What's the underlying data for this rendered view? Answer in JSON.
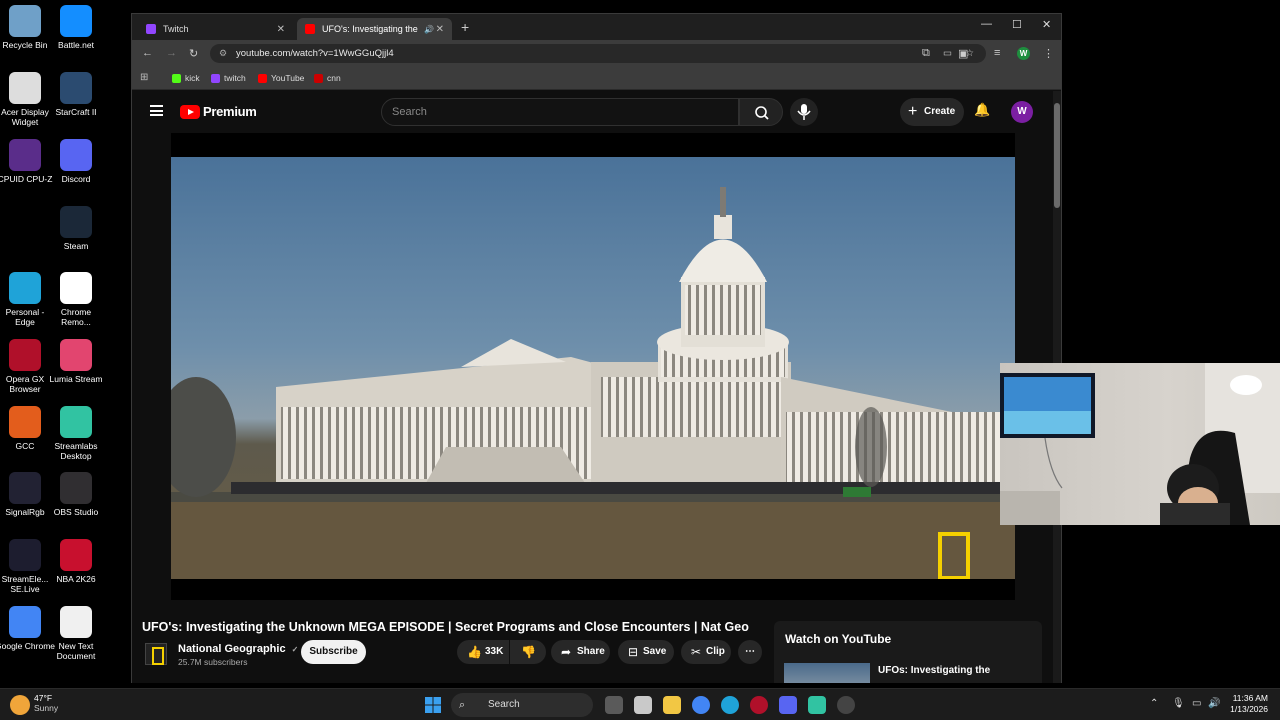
{
  "desktop": {
    "icons": [
      {
        "label": "Recycle Bin",
        "color": "#6fa0c8"
      },
      {
        "label": "Battle.net",
        "color": "#148eff"
      },
      {
        "label": "Acer Display Widget",
        "color": "#dddddd"
      },
      {
        "label": "StarCraft II",
        "color": "#2b4b70"
      },
      {
        "label": "CPUID CPU-Z",
        "color": "#5a2d8a"
      },
      {
        "label": "Discord",
        "color": "#5865f2"
      },
      {
        "label": "Steam",
        "color": "#1b2838"
      },
      {
        "label": "Personal - Edge",
        "color": "#1fa3d8"
      },
      {
        "label": "Chrome Remo...",
        "color": "#ffffff"
      },
      {
        "label": "Opera GX Browser",
        "color": "#b0102a"
      },
      {
        "label": "Lumia Stream",
        "color": "#e2456f"
      },
      {
        "label": "GCC",
        "color": "#e35d1c"
      },
      {
        "label": "Streamlabs Desktop",
        "color": "#31c3a2"
      },
      {
        "label": "SignalRgb",
        "color": "#222233"
      },
      {
        "label": "OBS Studio",
        "color": "#302e31"
      },
      {
        "label": "StreamEle... SE.Live",
        "color": "#1d1d2f"
      },
      {
        "label": "NBA 2K26",
        "color": "#c8102e"
      },
      {
        "label": "Google Chrome",
        "color": "#4285f4"
      },
      {
        "label": "New Text Document",
        "color": "#f0f0f0"
      }
    ]
  },
  "browser": {
    "tabs": [
      {
        "label": "Twitch",
        "favicon_color": "#9146ff"
      },
      {
        "label": "UFO's: Investigating the Un",
        "favicon_color": "#ff0000"
      }
    ],
    "url": "youtube.com/watch?v=1WwGGuQjjl4",
    "bookmarks": [
      {
        "label": "kick",
        "color": "#53fc18"
      },
      {
        "label": "twitch",
        "color": "#9146ff"
      },
      {
        "label": "YouTube",
        "color": "#ff0000"
      },
      {
        "label": "cnn",
        "color": "#cc0000"
      }
    ],
    "profile_initial": "W"
  },
  "youtube": {
    "logo_text": "Premium",
    "search_placeholder": "Search",
    "create_label": "Create",
    "avatar_initial": "W",
    "video_title": "UFO's: Investigating the Unknown MEGA EPISODE | Secret Programs and Close Encounters | Nat Geo",
    "channel_name": "National Geographic",
    "channel_verified": "✓",
    "subscribers": "25.7M subscribers",
    "subscribe_label": "Subscribe",
    "like_count": "33K",
    "share_label": "Share",
    "save_label": "Save",
    "clip_label": "Clip",
    "more_label": "⋯",
    "watch_on_youtube": "Watch on YouTube",
    "side_video_title": "UFOs: Investigating the"
  },
  "taskbar": {
    "weather_temp": "47°F",
    "weather_desc": "Sunny",
    "search_label": "Search",
    "time": "11:36 AM",
    "date": "1/13/2026"
  }
}
